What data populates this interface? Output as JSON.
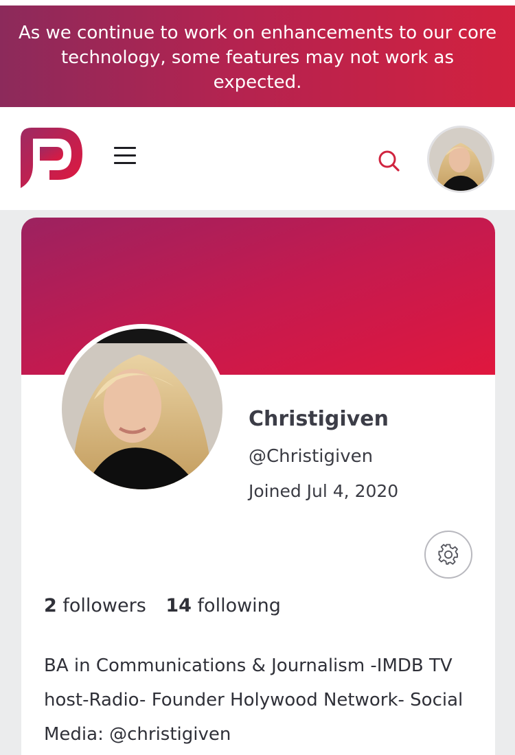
{
  "banner": {
    "message": "As we continue to work on enhancements to our core technology, some features may not work as expected."
  },
  "navbar": {
    "logo_icon": "parler-logo-icon",
    "menu_icon": "hamburger-menu-icon",
    "search_icon": "search-icon",
    "avatar_icon": "user-avatar"
  },
  "profile": {
    "display_name": "Christigiven",
    "handle": "@Christigiven",
    "joined": "Joined Jul 4, 2020",
    "followers_count": "2",
    "followers_label": " followers",
    "following_count": "14",
    "following_label": " following",
    "bio": "BA in Communications & Journalism -IMDB TV host-Radio- Founder Holywood Network- Social Media: @christigiven",
    "settings_icon": "gear-icon"
  },
  "colors": {
    "brand_start": "#8c2a5b",
    "brand_end": "#e0173e",
    "search_icon": "#d0243f",
    "background": "#ebeced"
  }
}
